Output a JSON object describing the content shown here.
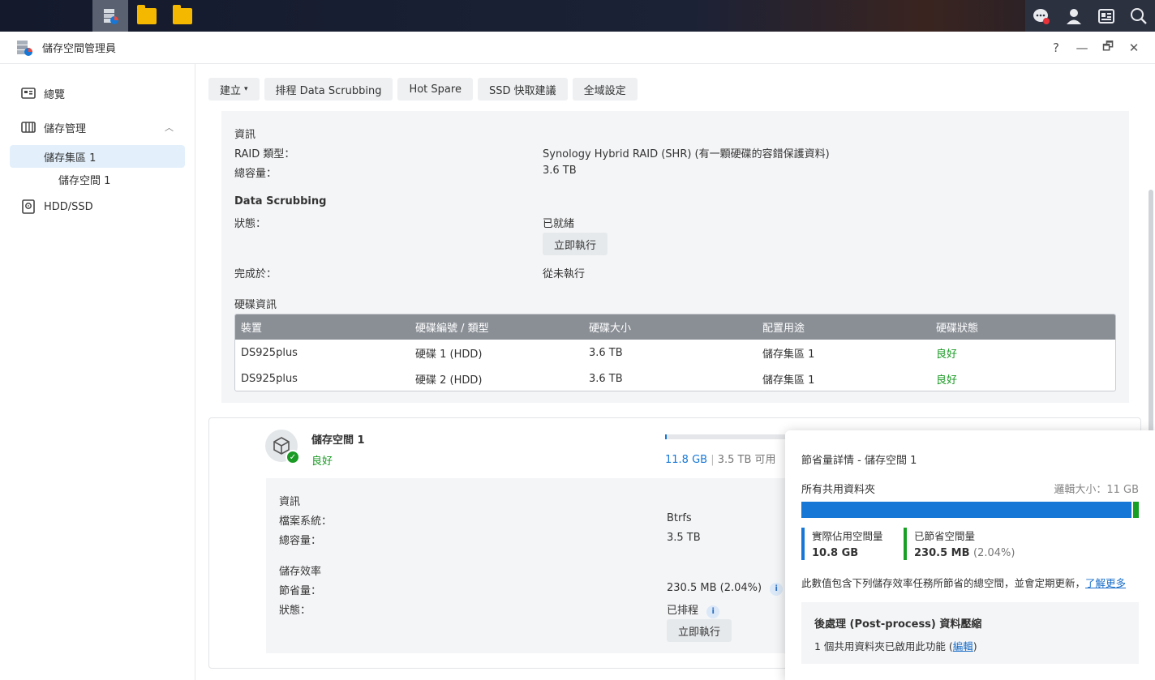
{
  "app": {
    "title": "儲存空間管理員"
  },
  "window_controls": {
    "help": "?",
    "minimize": "—",
    "restore": "🗗",
    "close": "✕"
  },
  "sidebar": {
    "items": [
      {
        "label": "總覽",
        "icon": "overview-icon"
      },
      {
        "label": "儲存管理",
        "icon": "storage-icon"
      },
      {
        "label": "儲存集區 1"
      },
      {
        "label": "儲存空間 1"
      },
      {
        "label": "HDD/SSD",
        "icon": "disk-icon"
      }
    ]
  },
  "toolbar": {
    "create": "建立",
    "scrubbing": "排程 Data Scrubbing",
    "hot_spare": "Hot Spare",
    "ssd_cache": "SSD 快取建議",
    "global": "全域設定"
  },
  "pool": {
    "info_title": "資訊",
    "raid_label": "RAID 類型：",
    "raid_value": "Synology Hybrid RAID (SHR) (有一顆硬碟的容錯保護資料)",
    "capacity_label": "總容量：",
    "capacity_value": "3.6 TB",
    "scrub_title": "Data Scrubbing",
    "status_label": "狀態：",
    "status_value": "已就緒",
    "run_now": "立即執行",
    "completed_label": "完成於：",
    "completed_value": "從未執行",
    "disk_title": "硬碟資訊",
    "table": {
      "headers": [
        "裝置",
        "硬碟編號 / 類型",
        "硬碟大小",
        "配置用途",
        "硬碟狀態"
      ],
      "rows": [
        [
          "DS925plus",
          "硬碟 1 (HDD)",
          "3.6 TB",
          "儲存集區 1",
          "良好"
        ],
        [
          "DS925plus",
          "硬碟 2 (HDD)",
          "3.6 TB",
          "儲存集區 1",
          "良好"
        ]
      ]
    }
  },
  "volume": {
    "name": "儲存空間 1",
    "status": "良好",
    "used": "11.8 GB",
    "separator": "|",
    "available": "3.5 TB 可用",
    "usage_fraction": 0.003,
    "info_title": "資訊",
    "fs_label": "檔案系統：",
    "fs_value": "Btrfs",
    "capacity_label": "總容量：",
    "capacity_value": "3.5 TB",
    "eff_title": "儲存效率",
    "saved_label": "節省量：",
    "saved_value": "230.5 MB (2.04%)",
    "status_label": "狀態：",
    "status_value": "已排程",
    "run_now": "立即執行",
    "info_icon": "i"
  },
  "popup": {
    "title": "節省量詳情 - 儲存空間 1",
    "all_folders": "所有共用資料夾",
    "logical_size": "邏輯大小：11 GB",
    "used_fraction": 0.98,
    "actual_label": "實際佔用空間量",
    "actual_value": "10.8 GB",
    "saved_label": "已節省空間量",
    "saved_value": "230.5 MB",
    "saved_pct": "(2.04%)",
    "desc": "此數值包含下列儲存效率任務所節省的總空間，並會定期更新，",
    "learn_more": "了解更多",
    "box_title": "後處理 (Post-process) 資料壓縮",
    "box_desc_pre": "1 個共用資料夾已啟用此功能 (",
    "box_link": "編輯",
    "box_desc_post": ")"
  },
  "colors": {
    "accent": "#1677d6",
    "good": "#1a9a24",
    "table_header": "#8a8f96"
  }
}
